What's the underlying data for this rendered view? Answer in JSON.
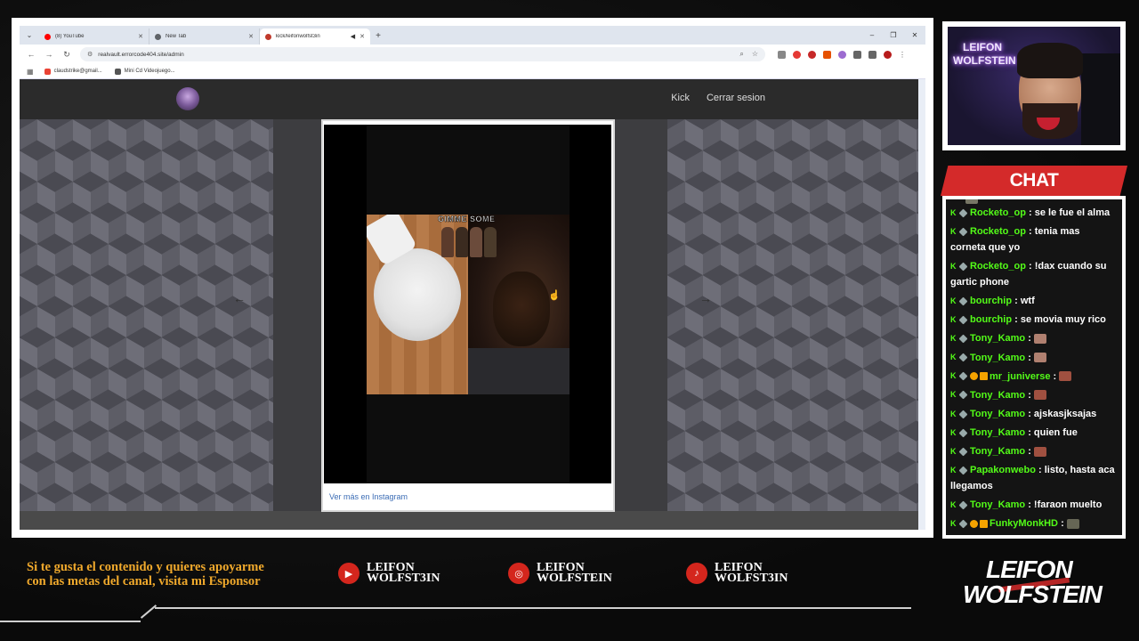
{
  "browser": {
    "tabs": [
      {
        "label": "(8) YouTube",
        "color": "#ff0000",
        "active": false
      },
      {
        "label": "New Tab",
        "color": "#5f6368",
        "active": false
      },
      {
        "label": "kick/leifonwolfst3in",
        "color": "#c0392b",
        "active": true
      }
    ],
    "url": "realvault.errorcode404.site/admin",
    "bookmarks": [
      {
        "label": "claudstrike@gmail...",
        "color": "#ea4335"
      },
      {
        "label": "Mini Cd Videojuego...",
        "color": "#555555"
      }
    ]
  },
  "site": {
    "nav": [
      "Kick",
      "Cerrar sesion"
    ],
    "instagram_link": "Ver más en Instagram",
    "sticker_title": "GIMME SOME"
  },
  "webcam": {
    "neon_sign_line1": "LEIFON",
    "neon_sign_line2": "WOLFSTEIN"
  },
  "chat": {
    "title": "CHAT",
    "messages": [
      {
        "user": "Rocketo_op",
        "text": ": se le fue el alma",
        "gold": false,
        "emote": null
      },
      {
        "user": "Rocketo_op",
        "text": ": tenia mas corneta que yo",
        "gold": false,
        "emote": null
      },
      {
        "user": "Rocketo_op",
        "text": ": !dax cuando su gartic phone",
        "gold": false,
        "emote": null
      },
      {
        "user": "bourchip",
        "text": ": wtf",
        "gold": false,
        "emote": null
      },
      {
        "user": "bourchip",
        "text": ": se movia muy rico",
        "gold": false,
        "emote": null
      },
      {
        "user": "Tony_Kamo",
        "text": ":",
        "gold": false,
        "emote": "#b08070"
      },
      {
        "user": "Tony_Kamo",
        "text": ":",
        "gold": false,
        "emote": "#b08070"
      },
      {
        "user": "mr_juniverse",
        "text": ":",
        "gold": true,
        "emote": "#a05040"
      },
      {
        "user": "Tony_Kamo",
        "text": ":",
        "gold": false,
        "emote": "#a05040"
      },
      {
        "user": "Tony_Kamo",
        "text": ": ajskasjksajas",
        "gold": false,
        "emote": null
      },
      {
        "user": "Tony_Kamo",
        "text": ": quien fue",
        "gold": false,
        "emote": null
      },
      {
        "user": "Tony_Kamo",
        "text": ":",
        "gold": false,
        "emote": "#a05040"
      },
      {
        "user": "Papakonwebo",
        "text": ": listo, hasta aca llegamos",
        "gold": false,
        "emote": null
      },
      {
        "user": "Tony_Kamo",
        "text": ": !faraon muelto",
        "gold": false,
        "emote": null
      },
      {
        "user": "FunkyMonkHD",
        "text": ":",
        "gold": true,
        "emote": "#666655"
      }
    ]
  },
  "bottom": {
    "sponsor_text": "Si te gusta el contenido y quieres apoyarme con las metas del canal, visita mi Esponsor",
    "socials": [
      {
        "icon": "youtube-icon",
        "glyph": "▶",
        "line1": "LEIFON",
        "line2": "WOLFST3IN"
      },
      {
        "icon": "instagram-icon",
        "glyph": "◎",
        "line1": "LEIFON",
        "line2": "WOLFSTEIN"
      },
      {
        "icon": "tiktok-icon",
        "glyph": "♪",
        "line1": "LEIFON",
        "line2": "WOLFST3IN"
      }
    ],
    "brand_line1": "LEIFON",
    "brand_line2": "WOLFSTEIN"
  },
  "colors": {
    "accent_red": "#d42a2a",
    "kick_green": "#53fc18",
    "sponsor_gold": "#f0a92c"
  }
}
